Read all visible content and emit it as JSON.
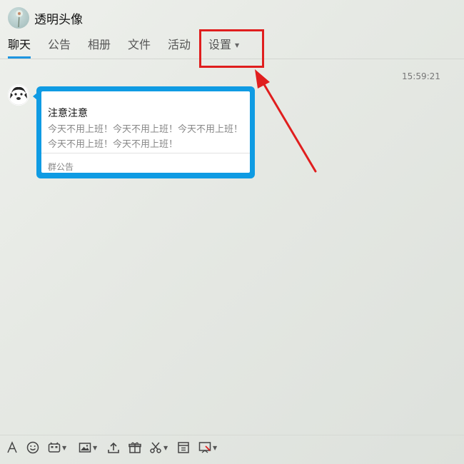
{
  "header": {
    "group_title": "透明头像",
    "tabs": [
      {
        "label": "聊天",
        "active": true
      },
      {
        "label": "公告"
      },
      {
        "label": "相册"
      },
      {
        "label": "文件"
      },
      {
        "label": "活动"
      },
      {
        "label": "设置",
        "has_dropdown": true
      }
    ]
  },
  "chat": {
    "timestamp": "15:59:21",
    "message": {
      "card_title": "注意注意",
      "card_body": "今天不用上班！今天不用上班！今天不用上班！今天不用上班！今天不用上班！",
      "card_footer": "群公告",
      "bubble_color": "#0f9be3"
    }
  },
  "annotation": {
    "color": "#e01e1e",
    "target": "settings-tab"
  },
  "toolbar": {
    "icons": [
      "font-icon",
      "emoji-icon",
      "magic-expression-icon",
      "image-icon",
      "upload-icon",
      "gift-icon",
      "scissors-icon",
      "history-icon",
      "screen-share-icon"
    ]
  },
  "colors": {
    "accent": "#1e96e0"
  }
}
